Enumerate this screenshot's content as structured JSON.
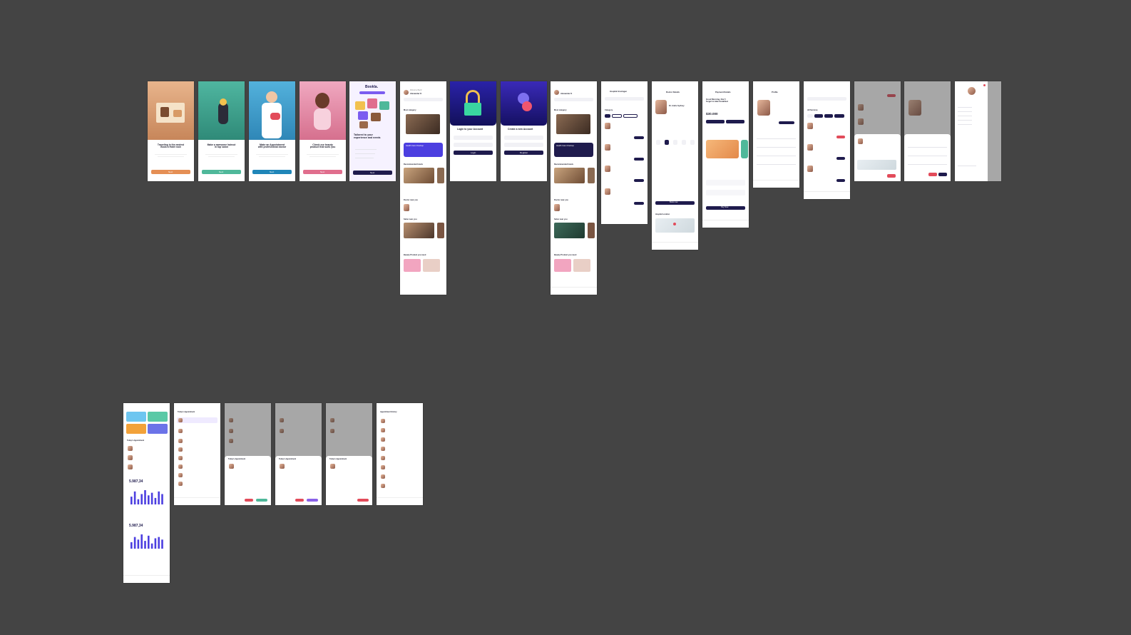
{
  "onboarding": [
    {
      "title": "Traveling is the easiest\nBook a Hotel now",
      "button": "Next",
      "color": "#e58f55"
    },
    {
      "title": "Make a awesome haircut\nin top salon",
      "button": "Next",
      "color": "#4fb89a"
    },
    {
      "title": "Make an Appointment\nwith professional doctor",
      "button": "Next",
      "color": "#1f86b8"
    },
    {
      "title": "Check our beauty\nproduct that suits you",
      "button": "Next",
      "color": "#e06e8d"
    }
  ],
  "bookla": {
    "logo": "Bookla.",
    "heading": "Tailored to your\nexperience and needs",
    "button": "Next"
  },
  "home": {
    "welcome": "Welcome Back!",
    "user": "Alexander K",
    "section_category": "Most category",
    "section_hotels": "Recommended hotels",
    "section_doctors": "Doctor near you",
    "section_salon": "Salon near you",
    "section_beauty": "Beauty Product you need",
    "banner": "Health Care Checkup"
  },
  "login": {
    "title": "Login to your Account",
    "button": "Login"
  },
  "register": {
    "title": "Create a new Account",
    "button": "Register"
  },
  "doctor_list": {
    "location": "Hospital Groningen",
    "header": "Category",
    "filters": [
      "All",
      "Dentist",
      "Cardiology",
      "Surgery"
    ]
  },
  "doctor_details": {
    "title": "Doctor Details",
    "name": "Dr. Andre Sydney",
    "book": "Book now",
    "location_label": "Hospital Location"
  },
  "payment": {
    "title": "Payment Details",
    "greeting": "Good Morning, Don't\nforget to take breakfast",
    "balance": "$30.000",
    "pay": "Pay Now"
  },
  "profile": {
    "title": "Profile"
  },
  "reviews": {
    "title": "All Services",
    "tabs": [
      "All",
      "Dentist",
      "Clinic",
      "Surgery"
    ]
  },
  "dashboard": {
    "card_colors": [
      "#6ec6f0",
      "#5ac9a6",
      "#f2a23a",
      "#6b73e8"
    ],
    "section": "Today's Appointment",
    "revenue": "5.987,34",
    "revenue2": "5.987,34",
    "bars": [
      6,
      10,
      4,
      8,
      11,
      7,
      9,
      5,
      10,
      8
    ],
    "bars2": [
      5,
      9,
      7,
      11,
      6,
      10,
      4,
      8,
      9,
      7
    ]
  },
  "appointments": {
    "title": "Today's Appointment",
    "history_title": "Appointment History"
  }
}
